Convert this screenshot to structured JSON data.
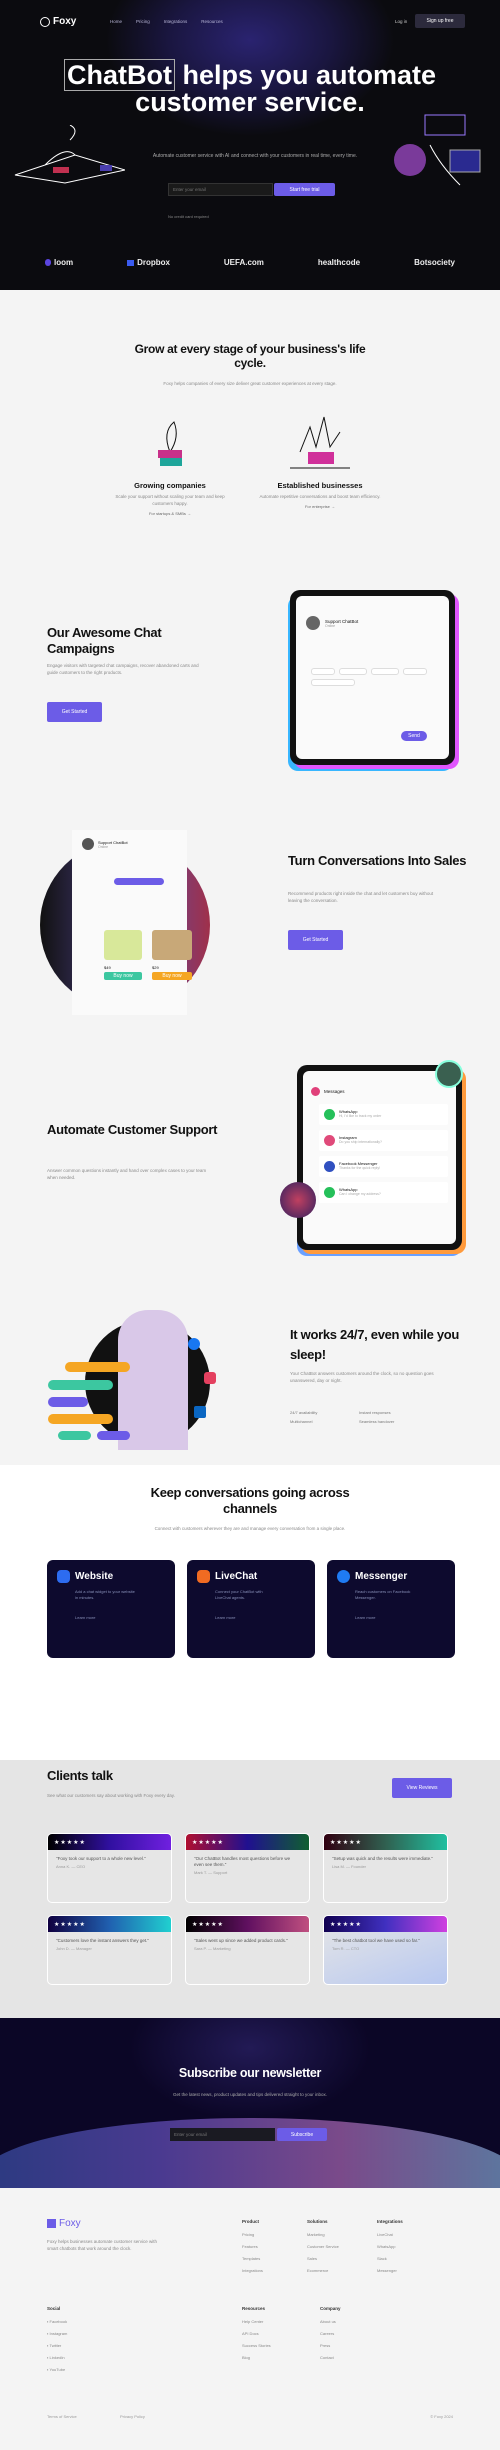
{
  "nav": {
    "brand": "Foxy",
    "links": [
      "Home",
      "Pricing",
      "Integrations",
      "Resources"
    ],
    "login": "Log in",
    "signup": "Sign up free"
  },
  "hero": {
    "title_highlight": "ChatBot",
    "title_rest": "helps you automate customer service.",
    "subtitle": "Automate customer service with AI and connect with your customers in real time, every time.",
    "email_placeholder": "Enter your email",
    "cta": "Start free trial",
    "note": "No credit card required"
  },
  "logos": [
    "loom",
    "Dropbox",
    "UEFA.com",
    "healthcode",
    "Botsociety"
  ],
  "grow": {
    "title": "Grow at every stage of your business's life cycle.",
    "subtitle": "Foxy helps companies of every size deliver great customer experiences at every stage.",
    "items": [
      {
        "title": "Growing companies",
        "desc": "Scale your support without scaling your team and keep customers happy.",
        "link": "For startups & SMBs →"
      },
      {
        "title": "Established businesses",
        "desc": "Automate repetitive conversations and boost team efficiency.",
        "link": "For enterprise →"
      }
    ]
  },
  "campaigns": {
    "title": "Our Awesome Chat Campaigns",
    "desc": "Engage visitors with targeted chat campaigns, recover abandoned carts and guide customers to the right products.",
    "cta": "Get Started",
    "mock": {
      "agent": "Support ChatBot",
      "status": "Online",
      "send": "Send"
    }
  },
  "sales": {
    "title": "Turn Conversations Into Sales",
    "desc": "Recommend products right inside the chat and let customers buy without leaving the conversation.",
    "cta": "Get Started",
    "mock": {
      "agent": "Support ChatBot",
      "status": "Online",
      "products": [
        {
          "price": "$49",
          "button": "Buy now"
        },
        {
          "price": "$29",
          "button": "Buy now"
        }
      ]
    }
  },
  "support": {
    "title": "Automate Customer Support",
    "desc": "Answer common questions instantly and hand over complex cases to your team when needed.",
    "mock": {
      "header": "Messages",
      "items": [
        {
          "name": "WhatsApp",
          "text": "Hi, I'd like to track my order"
        },
        {
          "name": "Instagram",
          "text": "Do you ship internationally?"
        },
        {
          "name": "Facebook Messenger",
          "text": "Thanks for the quick reply!"
        },
        {
          "name": "WhatsApp",
          "text": "Can I change my address?"
        }
      ]
    }
  },
  "always": {
    "title": "It works 24/7, even while you sleep!",
    "desc": "Your ChatBot answers customers around the clock, so no question goes unanswered, day or night.",
    "bullets": [
      "24/7 availability",
      "Instant responses",
      "Multichannel",
      "Seamless handover"
    ]
  },
  "channels": {
    "title": "Keep conversations going across channels",
    "subtitle": "Connect with customers wherever they are and manage every conversation from a single place.",
    "cards": [
      {
        "name": "Website",
        "desc": "Add a chat widget to your website in minutes.",
        "link": "Learn more",
        "color": "#2d6cf0"
      },
      {
        "name": "LiveChat",
        "desc": "Connect your ChatBot with LiveChat agents.",
        "link": "Learn more",
        "color": "#f06b22"
      },
      {
        "name": "Messenger",
        "desc": "Reach customers on Facebook Messenger.",
        "link": "Learn more",
        "color": "#1f7bf2"
      }
    ]
  },
  "clients": {
    "title": "Clients talk",
    "subtitle": "See what our customers say about working with Foxy every day.",
    "cta": "View Reviews",
    "stars": "★★★★★",
    "reviews": [
      {
        "quote": "\"Foxy took our support to a whole new level.\"",
        "author": "Anna K. — CEO"
      },
      {
        "quote": "\"Our ChatBot handles most questions before we even see them.\"",
        "author": "Mark T. — Support"
      },
      {
        "quote": "\"Setup was quick and the results were immediate.\"",
        "author": "Lisa M. — Founder"
      },
      {
        "quote": "\"Customers love the instant answers they get.\"",
        "author": "John D. — Manager"
      },
      {
        "quote": "\"Sales went up since we added product cards.\"",
        "author": "Sara P. — Marketing"
      },
      {
        "quote": "\"The best chatbot tool we have used so far.\"",
        "author": "Tom R. — CTO"
      }
    ]
  },
  "newsletter": {
    "title": "Subscribe our newsletter",
    "subtitle": "Get the latest news, product updates and tips delivered straight to your inbox.",
    "placeholder": "Enter your email",
    "cta": "Subscribe"
  },
  "footer": {
    "brand": "Foxy",
    "desc": "Foxy helps businesses automate customer service with smart chatbots that work around the clock.",
    "columns": [
      {
        "title": "Product",
        "items": [
          "Pricing",
          "Features",
          "Templates",
          "Integrations"
        ]
      },
      {
        "title": "Solutions",
        "items": [
          "Marketing",
          "Customer Service",
          "Sales",
          "Ecommerce"
        ]
      },
      {
        "title": "Integrations",
        "items": [
          "LiveChat",
          "WhatsApp",
          "Slack",
          "Messenger"
        ]
      }
    ],
    "social": {
      "title": "Social",
      "items": [
        "Facebook",
        "Instagram",
        "Twitter",
        "LinkedIn",
        "YouTube"
      ]
    },
    "columns2": [
      {
        "title": "Resources",
        "items": [
          "Help Center",
          "API Docs",
          "Success Stories",
          "Blog"
        ]
      },
      {
        "title": "Company",
        "items": [
          "About us",
          "Careers",
          "Press",
          "Contact"
        ]
      }
    ],
    "bottom": [
      "Terms of Service",
      "Privacy Policy",
      "© Foxy 2024"
    ]
  },
  "colors": {
    "accent": "#6c5ce7",
    "dark": "#0b0b0f",
    "navy": "#0d0a2e"
  }
}
